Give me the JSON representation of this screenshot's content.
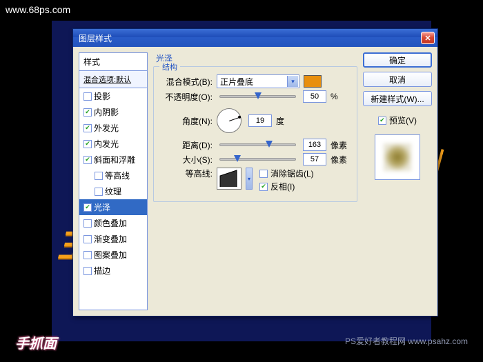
{
  "watermarks": {
    "top": "www.68ps.com",
    "bl": "手抓面",
    "br": "PS爱好者教程网  www.psahz.com"
  },
  "dialog": {
    "title": "图层样式"
  },
  "styles_panel": {
    "header": "样式",
    "sub": "混合选项:默认",
    "items": [
      {
        "label": "投影",
        "checked": false,
        "indent": false
      },
      {
        "label": "内阴影",
        "checked": true,
        "indent": false
      },
      {
        "label": "外发光",
        "checked": true,
        "indent": false
      },
      {
        "label": "内发光",
        "checked": true,
        "indent": false
      },
      {
        "label": "斜面和浮雕",
        "checked": true,
        "indent": false
      },
      {
        "label": "等高线",
        "checked": false,
        "indent": true
      },
      {
        "label": "纹理",
        "checked": false,
        "indent": true
      },
      {
        "label": "光泽",
        "checked": true,
        "indent": false,
        "selected": true
      },
      {
        "label": "颜色叠加",
        "checked": false,
        "indent": false
      },
      {
        "label": "渐变叠加",
        "checked": false,
        "indent": false
      },
      {
        "label": "图案叠加",
        "checked": false,
        "indent": false
      },
      {
        "label": "描边",
        "checked": false,
        "indent": false
      }
    ]
  },
  "main": {
    "title": "光泽",
    "fieldset_title": "结构",
    "blend_label": "混合模式(B):",
    "blend_value": "正片叠底",
    "opacity_label": "不透明度(O):",
    "opacity_value": "50",
    "opacity_unit": "%",
    "angle_label": "角度(N):",
    "angle_value": "19",
    "angle_unit": "度",
    "distance_label": "距离(D):",
    "distance_value": "163",
    "distance_unit": "像素",
    "size_label": "大小(S):",
    "size_value": "57",
    "size_unit": "像素",
    "contour_label": "等高线:",
    "antialias_label": "消除锯齿(L)",
    "antialias_checked": false,
    "invert_label": "反相(I)",
    "invert_checked": true,
    "swatch_color": "#e88f0d"
  },
  "buttons": {
    "ok": "确定",
    "cancel": "取消",
    "new_style": "新建样式(W)...",
    "preview": "预览(V)"
  },
  "slider_pos": {
    "opacity": "50%",
    "distance": "65%",
    "size": "23%"
  }
}
